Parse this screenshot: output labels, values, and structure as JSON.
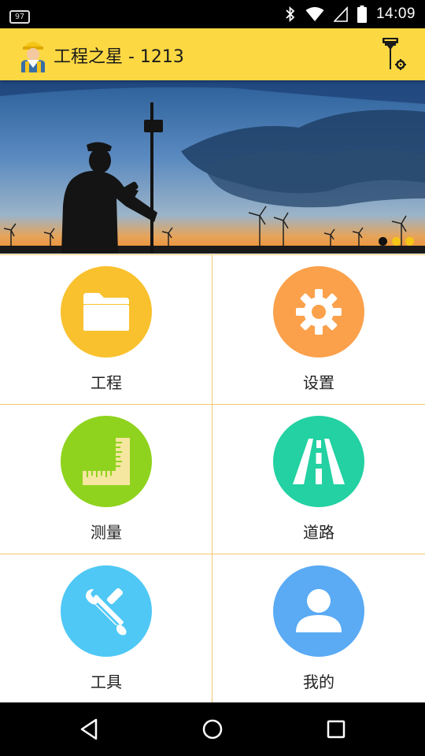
{
  "status_bar": {
    "notification_badge": "97",
    "time": "14:09",
    "icons": [
      "bluetooth-icon",
      "wifi-icon",
      "signal-icon",
      "battery-icon"
    ]
  },
  "app_bar": {
    "title": "工程之星 - 1213",
    "logo_icon": "surveyor-avatar-icon",
    "action_icon": "gnss-receiver-settings-icon",
    "color": "#fcd843"
  },
  "banner": {
    "image": "surveyor-silhouette-at-sunset",
    "page_count": 3,
    "active_index": 0,
    "dot_active_color": "#111111",
    "dot_inactive_color": "#f5c518"
  },
  "menu": [
    {
      "label": "工程",
      "icon": "folder-icon",
      "color": "#f9c12e"
    },
    {
      "label": "设置",
      "icon": "gear-icon",
      "color": "#fba14c"
    },
    {
      "label": "测量",
      "icon": "ruler-icon",
      "color": "#8fd31e"
    },
    {
      "label": "道路",
      "icon": "road-icon",
      "color": "#23d1a2"
    },
    {
      "label": "工具",
      "icon": "tools-icon",
      "color": "#4fc8f5"
    },
    {
      "label": "我的",
      "icon": "user-icon",
      "color": "#5aaaf4"
    }
  ],
  "nav_bar": {
    "buttons": [
      "back-icon",
      "home-icon",
      "recents-icon"
    ]
  }
}
